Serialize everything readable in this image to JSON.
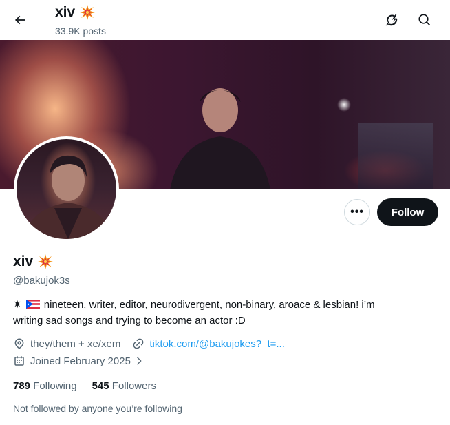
{
  "header": {
    "title": "xiv",
    "title_emoji": "collision-emoji",
    "posts_count": "33.9K posts",
    "icons": [
      "back-arrow-icon",
      "grok-icon",
      "search-icon"
    ]
  },
  "profile": {
    "display_name": "xiv",
    "handle": "@bakujok3s",
    "bio_emojis": [
      "sparkle-emoji",
      "puerto-rico-flag-emoji"
    ],
    "bio_line1": "nineteen, writer, editor, neurodivergent, non-binary, aroace & lesbian! i’m",
    "bio_line2": "writing sad songs and trying to become an actor :D",
    "pronouns": "they/them + xe/xem",
    "link": "tiktok.com/@bakujokes?_t=...",
    "joined": "Joined February 2025",
    "following_count": "789",
    "following_label": "Following",
    "followers_count": "545",
    "followers_label": "Followers",
    "not_followed_text": "Not followed by anyone you’re following"
  },
  "actions": {
    "more_label": "•••",
    "follow_label": "Follow"
  },
  "colors": {
    "text": "#0f1419",
    "secondary": "#536471",
    "link": "#1d9bf0",
    "follow_bg": "#0f1419"
  }
}
